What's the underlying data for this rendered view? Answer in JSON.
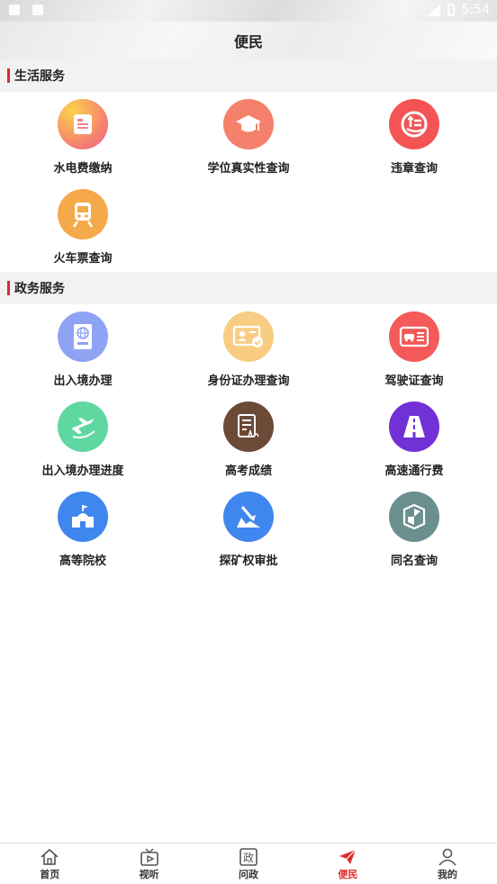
{
  "status": {
    "time": "5:54"
  },
  "header": {
    "title": "便民"
  },
  "sections": [
    {
      "title": "生活服务",
      "items": [
        {
          "label": "水电费缴纳",
          "icon": "bill-icon",
          "color": "#f26b7c"
        },
        {
          "label": "学位真实性查询",
          "icon": "graduation-cap-icon",
          "color": "#f5806b"
        },
        {
          "label": "违章查询",
          "icon": "violation-icon",
          "color": "#f45454"
        },
        {
          "label": "火车票查询",
          "icon": "train-icon",
          "color": "#f5a94a"
        }
      ]
    },
    {
      "title": "政务服务",
      "items": [
        {
          "label": "出入境办理",
          "icon": "passport-icon",
          "color": "#8fa3f5"
        },
        {
          "label": "身份证办理查询",
          "icon": "id-card-icon",
          "color": "#f8cd83"
        },
        {
          "label": "驾驶证查询",
          "icon": "driver-license-icon",
          "color": "#f45a5a"
        },
        {
          "label": "出入境办理进度",
          "icon": "airplane-icon",
          "color": "#5fd7a0"
        },
        {
          "label": "高考成绩",
          "icon": "exam-score-icon",
          "color": "#6b4a37"
        },
        {
          "label": "高速通行费",
          "icon": "highway-icon",
          "color": "#7131d6"
        },
        {
          "label": "高等院校",
          "icon": "university-icon",
          "color": "#3f87ee"
        },
        {
          "label": "探矿权审批",
          "icon": "mining-icon",
          "color": "#3f87ee"
        },
        {
          "label": "同名查询",
          "icon": "shield-icon",
          "color": "#6a8f8e"
        }
      ]
    }
  ],
  "tabs": [
    {
      "label": "首页",
      "icon": "home-icon"
    },
    {
      "label": "视听",
      "icon": "tv-icon"
    },
    {
      "label": "问政",
      "icon": "politics-icon",
      "glyph": "政"
    },
    {
      "label": "便民",
      "icon": "paper-plane-icon",
      "active": true
    },
    {
      "label": "我的",
      "icon": "user-icon"
    }
  ],
  "colors": {
    "accent": "#e02a2a"
  }
}
